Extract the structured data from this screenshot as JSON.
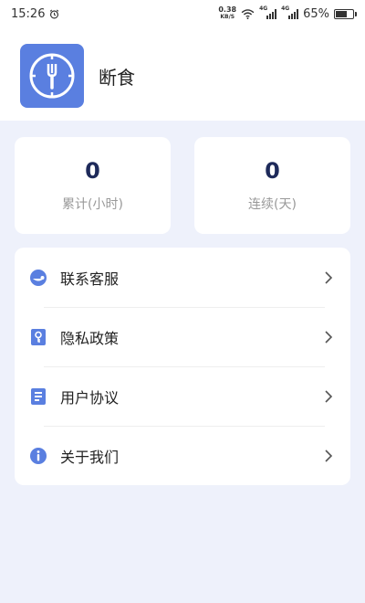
{
  "status": {
    "time": "15:26",
    "speed": "0.38",
    "speed_unit": "KB/S",
    "net1": "4G",
    "net2": "4G",
    "battery": "65%",
    "battery_level": 0.65
  },
  "app": {
    "title": "断食"
  },
  "stats": [
    {
      "value": "0",
      "label": "累计(小时)"
    },
    {
      "value": "0",
      "label": "连续(天)"
    }
  ],
  "menu": [
    {
      "label": "联系客服",
      "icon": "customer-service-icon"
    },
    {
      "label": "隐私政策",
      "icon": "privacy-key-icon"
    },
    {
      "label": "用户协议",
      "icon": "document-icon"
    },
    {
      "label": "关于我们",
      "icon": "info-icon"
    }
  ],
  "colors": {
    "accent": "#5a7fe0",
    "background": "#eef1fb",
    "stat_value": "#1e2a5a"
  }
}
